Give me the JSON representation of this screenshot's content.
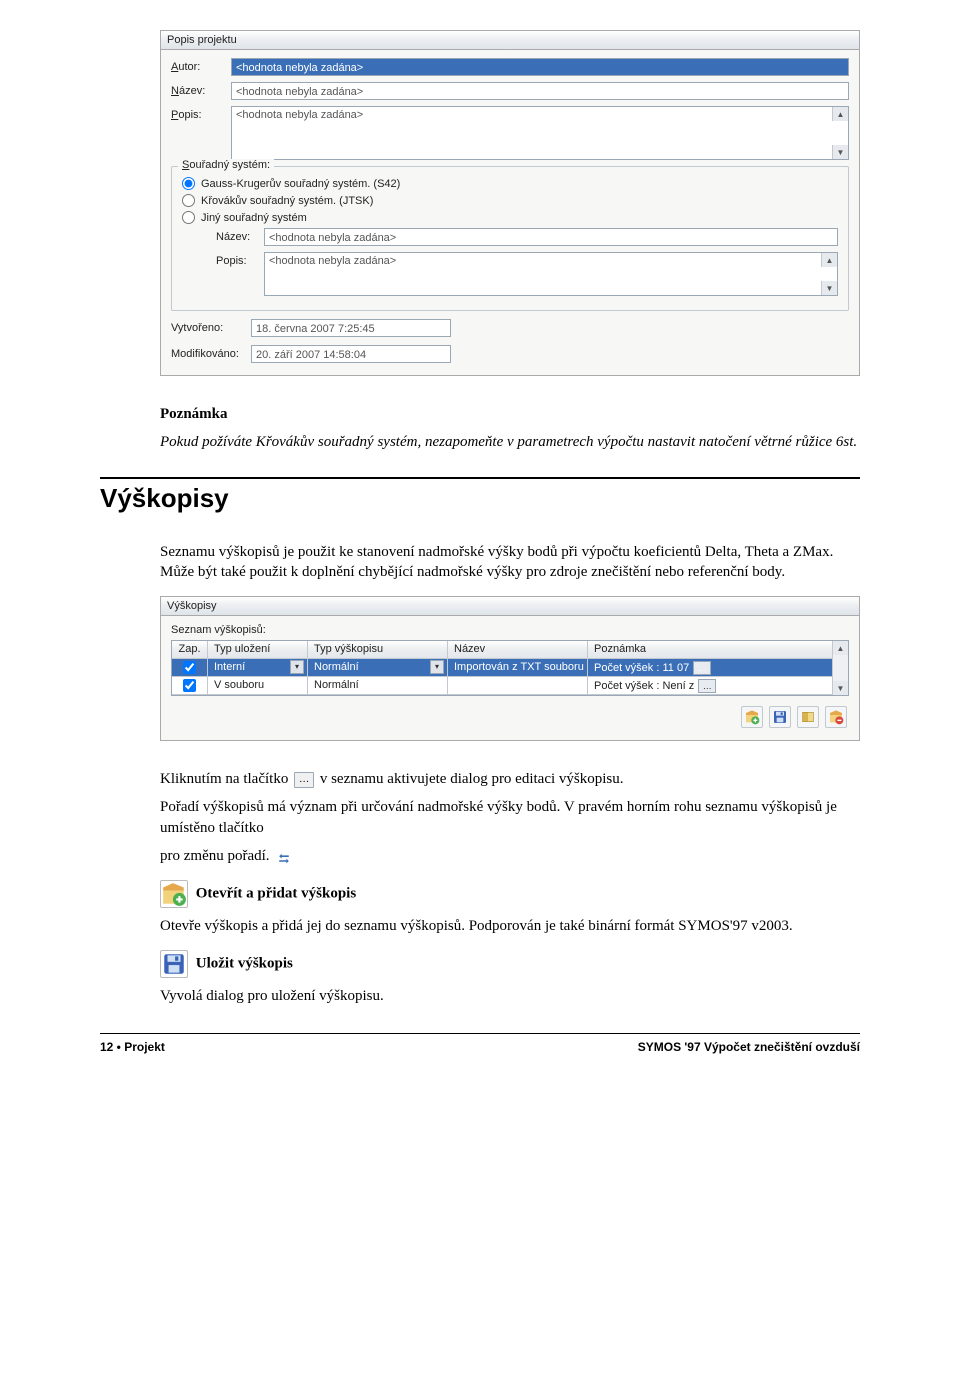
{
  "dialog1": {
    "title": "Popis projektu",
    "labels": {
      "author": "Autor:",
      "name": "Název:",
      "desc": "Popis:",
      "coord": "Souřadný systém:",
      "created": "Vytvořeno:",
      "modified": "Modifikováno:",
      "subname": "Název:",
      "subdesc": "Popis:"
    },
    "placeholder": "<hodnota nebyla zadána>",
    "radios": {
      "r1": "Gauss-Krugerův souřadný systém. (S42)",
      "r2": "Křovákův souřadný systém. (JTSK)",
      "r3": "Jiný souřadný systém"
    },
    "created_value": "18. června 2007 7:25:45",
    "modified_value": "20. září 2007 14:58:04"
  },
  "note": {
    "heading": "Poznámka",
    "body": "Pokud požíváte Křovákův souřadný systém, nezapomeňte v parametrech výpočtu nastavit natočení větrné růžice 6st."
  },
  "section_heading": "Výškopisy",
  "section_intro": "Seznamu výškopisů je použit ke stanovení nadmořské výšky bodů při výpočtu koeficientů Delta, Theta a ZMax. Může být také použit k doplnění chybějící nadmořské výšky pro zdroje znečištění nebo referenční body.",
  "dialog2": {
    "title": "Výškopisy",
    "listlabel": "Seznam výškopisů:",
    "columns": {
      "c1": "Zap.",
      "c2": "Typ uložení",
      "c3": "Typ výškopisu",
      "c4": "Název",
      "c5": "Poznámka"
    },
    "rows": [
      {
        "zap": true,
        "c2": "Interní",
        "c3": "Normální",
        "c4": "Importován z TXT souboru",
        "c5": "Počet výšek : 11 07",
        "sel": true,
        "dd2": true,
        "dd3": true,
        "btn": true
      },
      {
        "zap": true,
        "c2": "V souboru",
        "c3": "Normální",
        "c4": "",
        "c5": "Počet výšek : Není z",
        "sel": false,
        "dd2": false,
        "dd3": false,
        "btn": true
      }
    ]
  },
  "paragraphs": {
    "p1a": "Kliknutím na tlačítko ",
    "p1b": " v seznamu aktivujete dialog pro editaci výškopisu.",
    "p2": "Pořadí výškopisů má význam při určování nadmořské výšky bodů. V pravém horním rohu seznamu výškopisů je umístěno tlačítko",
    "p3a": "pro změnu pořadí. ",
    "feat1_title": "Otevřít a přidat výškopis",
    "feat1_body": "Otevře výškopis a přidá jej do seznamu výškopisů. Podporován je také binární formát SYMOS'97 v2003.",
    "feat2_title": "Uložit výškopis",
    "feat2_body": "Vyvolá dialog pro uložení výškopisu."
  },
  "footer": {
    "left": "12 • Projekt",
    "right": "SYMOS '97 Výpočet znečištění ovzduší"
  }
}
